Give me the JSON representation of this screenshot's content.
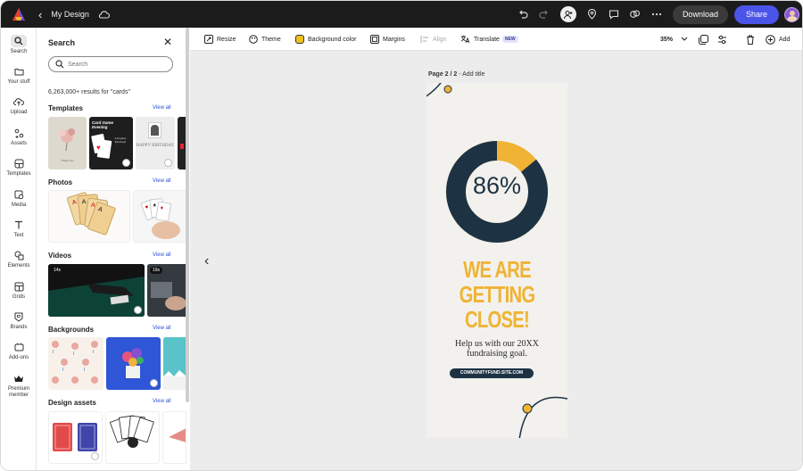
{
  "app": {
    "title": "My Design"
  },
  "topbar": {
    "download_label": "Download",
    "share_label": "Share"
  },
  "rail": {
    "items": [
      {
        "label": "Search"
      },
      {
        "label": "Your stuff"
      },
      {
        "label": "Upload"
      },
      {
        "label": "Assets"
      },
      {
        "label": "Templates"
      },
      {
        "label": "Media"
      },
      {
        "label": "Text"
      },
      {
        "label": "Elements"
      },
      {
        "label": "Grids"
      },
      {
        "label": "Brands"
      },
      {
        "label": "Add-ons"
      },
      {
        "label": "Premium member"
      }
    ]
  },
  "panel": {
    "title": "Search",
    "search_placeholder": "Search",
    "results_text": "6,263,000+ results for \"cards\"",
    "sections": [
      {
        "title": "Templates",
        "view_all": "View all"
      },
      {
        "title": "Photos",
        "view_all": "View all"
      },
      {
        "title": "Videos",
        "view_all": "View all"
      },
      {
        "title": "Backgrounds",
        "view_all": "View all"
      },
      {
        "title": "Design assets",
        "view_all": "View all"
      }
    ],
    "video_durations": [
      "14s",
      "19s"
    ],
    "template_texts": {
      "card1": "Thank You",
      "card2_title": "Card Game Evening",
      "card2_sub": "Company Evenings",
      "card3": "HAPPY BIRTHDAY"
    }
  },
  "toolbar": {
    "resize": "Resize",
    "theme": "Theme",
    "background_color": "Background color",
    "margins": "Margins",
    "align": "Align",
    "translate": "Translate",
    "new_badge": "NEW",
    "zoom": "35%",
    "add": "Add"
  },
  "canvas": {
    "page_label": "Page 2 / 2",
    "page_title_placeholder": "Add title"
  },
  "poster": {
    "percent": "86%",
    "percent_value": 0.86,
    "headline_lines": [
      "WE ARE",
      "GETTING",
      "CLOSE!"
    ],
    "subtext": "Help us with our 20XX fundraising goal.",
    "url": "COMMUNITYFUND.SITE.COM"
  },
  "colors": {
    "accent": "#f0b334",
    "navy": "#1d3344",
    "share": "#4b54e8",
    "topbar": "#1b1b1b"
  }
}
